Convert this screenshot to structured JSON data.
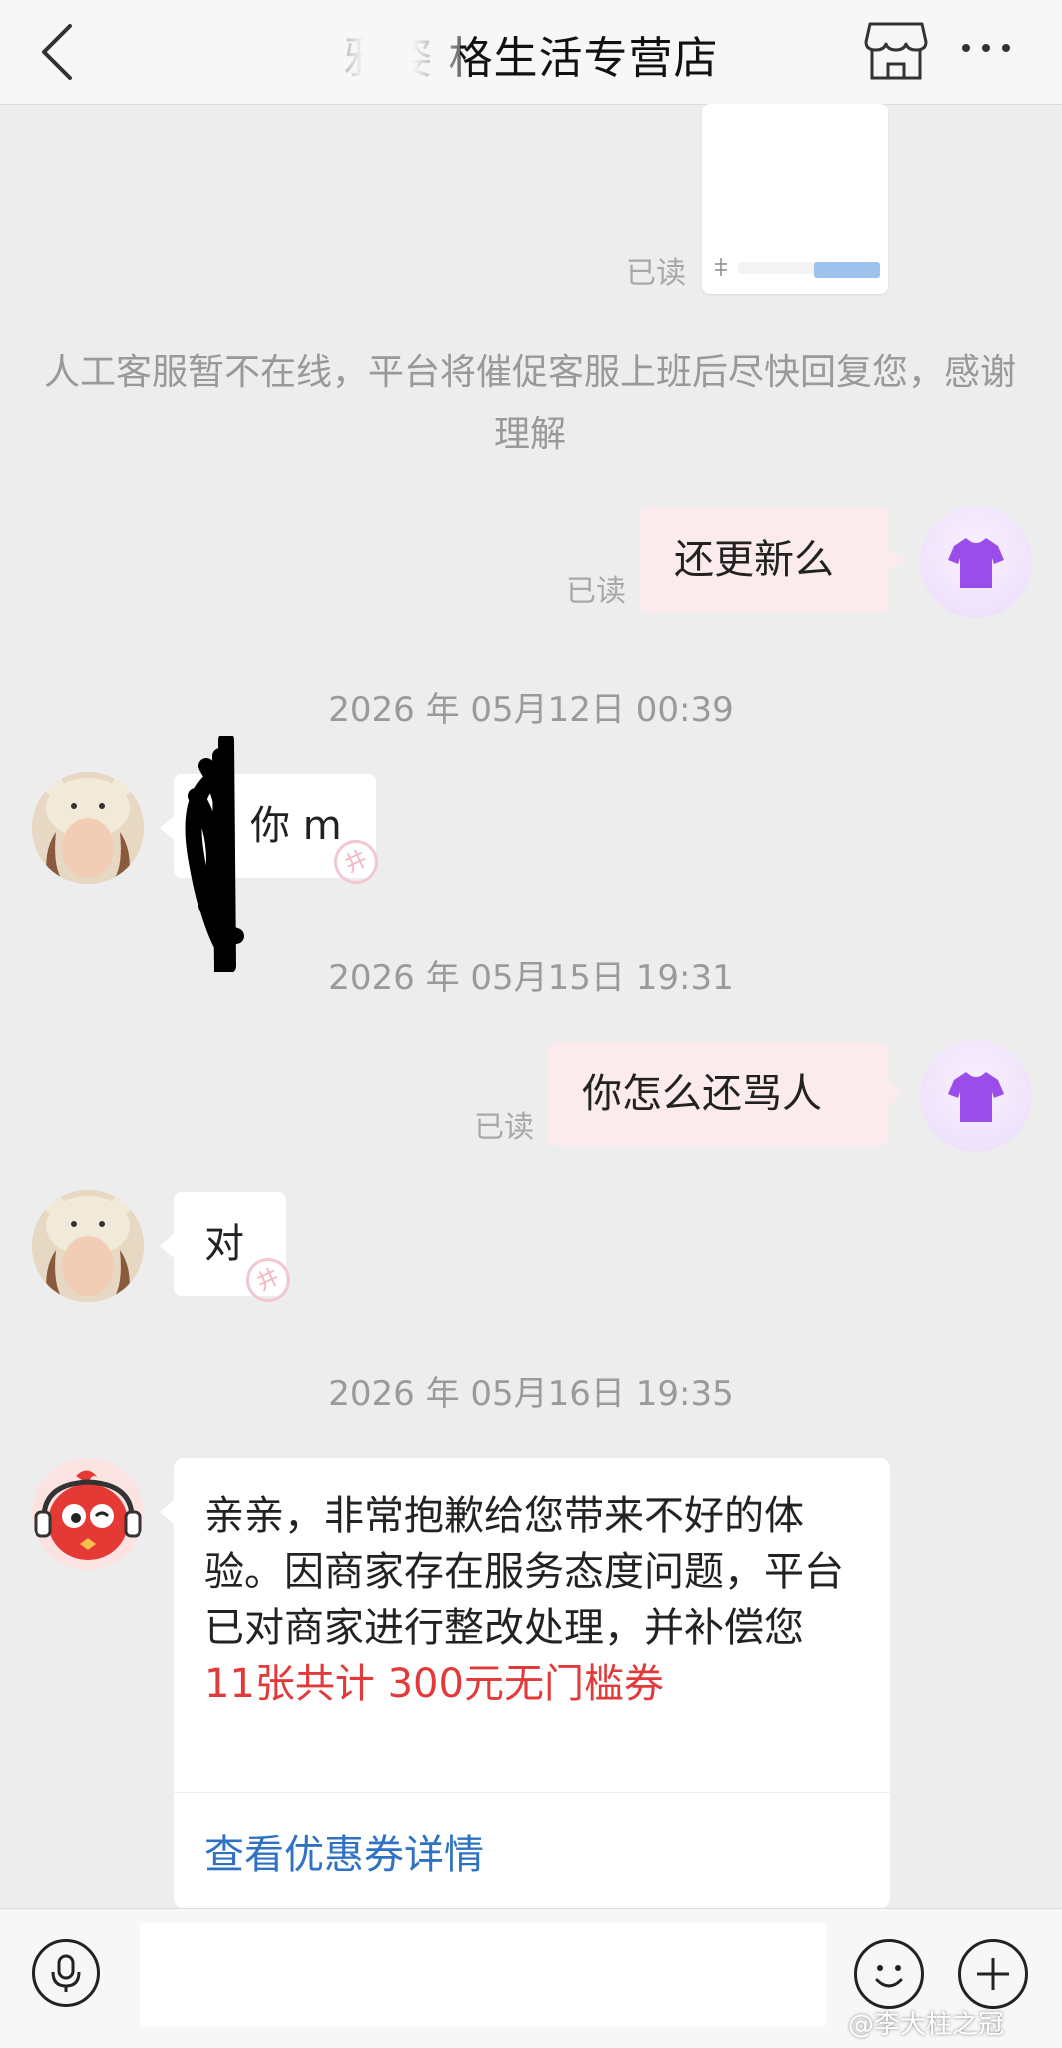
{
  "header": {
    "title": "雅姿  格生活专营店",
    "back_icon": "chevron-left-icon",
    "store_icon": "store-icon",
    "more_icon": "more-dots-icon"
  },
  "messages": {
    "read_top": "已读",
    "system_notice": "人工客服暂不在线，平台将催促客服上班后尽快回复您，感谢理解",
    "out1": {
      "text": "还更新么",
      "read": "已读"
    },
    "ts1": "2026 年 05月12日 00:39",
    "in1": {
      "text": "你 m"
    },
    "ts2": "2026 年 05月15日 19:31",
    "out2": {
      "text": "你怎么还骂人",
      "read": "已读"
    },
    "in2": {
      "text": "对"
    },
    "ts3": "2026 年 05月16日 19:35",
    "bot": {
      "text_part1": "亲亲，非常抱歉给您带来不好的体验。因商家存在服务态度问题，平台已对商家进行整改处理，并补偿您 ",
      "text_highlight": "11张共计 300元无门槛券",
      "link": "查看优惠券详情"
    }
  },
  "stamp_text": "井",
  "input_bar": {
    "mic_icon": "microphone-icon",
    "emoji_icon": "emoji-icon",
    "plus_icon": "plus-icon"
  },
  "watermark": "@李大柱之冠",
  "colors": {
    "out_bubble": "#fcebed",
    "highlight": "#e23a3a",
    "link": "#2f72c4",
    "user_icon": "#9b4dea"
  }
}
